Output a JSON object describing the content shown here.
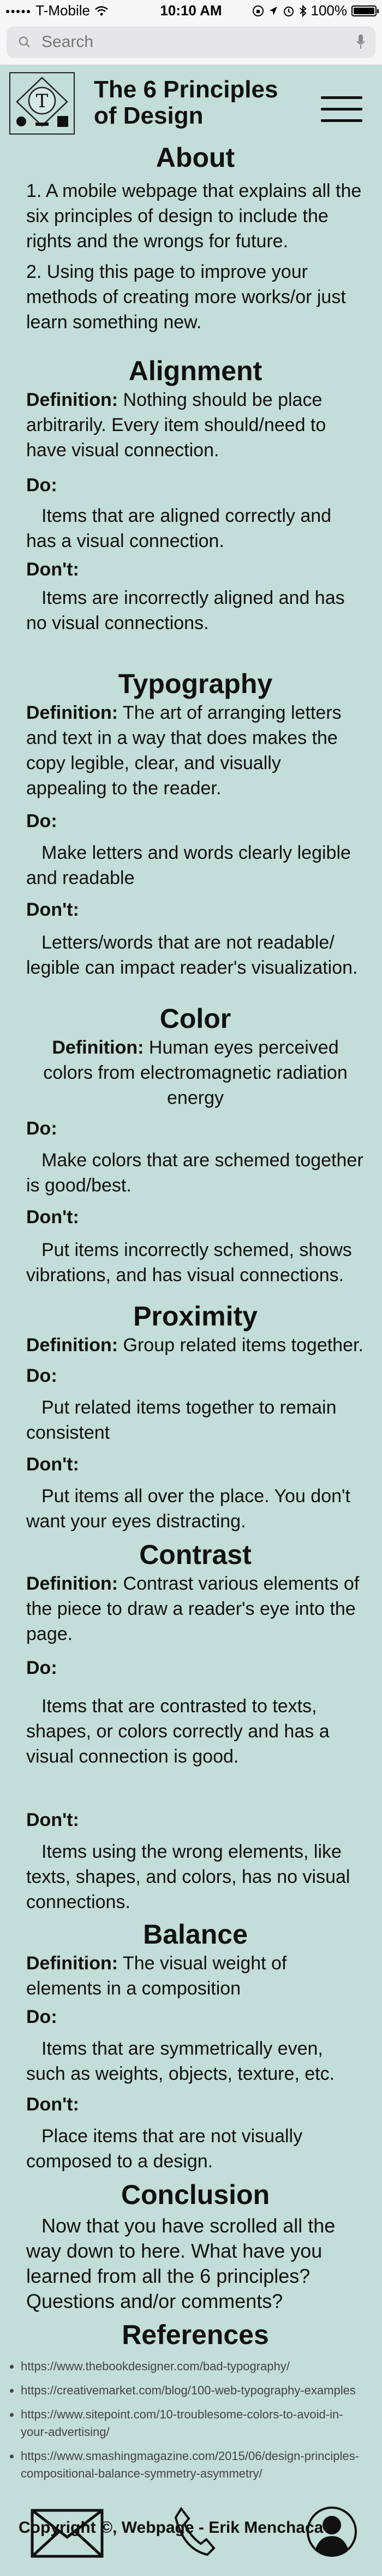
{
  "status_bar": {
    "carrier": "T-Mobile",
    "time": "10:10 AM",
    "battery": "100%",
    "battery_level": 1.0
  },
  "search": {
    "placeholder": "Search"
  },
  "header": {
    "logo_letter": "T",
    "title_line1": "The 6 Principles",
    "title_line2": "of Design"
  },
  "about": {
    "title": "About",
    "items": [
      "1.  A mobile webpage that explains all the six principles of design to include the rights and the wrongs for future.",
      "2.  Using this page to improve your methods of creating more works/or just learn something new."
    ]
  },
  "labels": {
    "definition": "Definition:",
    "do": "Do:",
    "dont": "Don't:"
  },
  "principles": [
    {
      "title": "Alignment",
      "definition": "Nothing should be place arbitrarily. Every item should/need to have visual connection.",
      "do": "Items that are aligned correctly and has a visual connection.",
      "dont": "Items are incorrectly aligned and has no visual connections."
    },
    {
      "title": "Typography",
      "definition": "The art of arranging letters and text in a way that does makes the copy legible, clear, and visually appealing to the reader.",
      "do": "Make letters and words clearly legible and readable",
      "dont": "Letters/words that are not readable/ legible can impact reader's visualization."
    },
    {
      "title": "Color",
      "definition": "Human eyes perceived colors from electromagnetic radiation energy",
      "do": "Make colors that are schemed together is good/best.",
      "dont": "Put items incorrectly schemed, shows vibrations, and has visual connections."
    },
    {
      "title": "Proximity",
      "definition": "Group related items together.",
      "do": "Put related items together to remain consistent",
      "dont": "Put items all over the place. You don't want your eyes distracting."
    },
    {
      "title": "Contrast",
      "definition": "Contrast various elements of the piece to draw a reader's eye into the page.",
      "do": "Items that are contrasted to texts, shapes, or colors correctly and has a visual connection is good.",
      "dont": "Items using the wrong elements, like texts, shapes, and colors, has no visual connections."
    },
    {
      "title": "Balance",
      "definition": "The visual weight of elements in a composition",
      "do": "Items that are symmetrically even, such as weights, objects, texture, etc.",
      "dont": "Place items that are not visually composed to a design."
    }
  ],
  "conclusion": {
    "title": "Conclusion",
    "text": "Now that you have scrolled all the way down to here. What have you learned from all the 6 principles? Questions and/or comments?"
  },
  "references": {
    "title": "References",
    "links": [
      "https://www.thebookdesigner.com/bad-typography/",
      "https://creativemarket.com/blog/100-web-typography-examples",
      "https://www.sitepoint.com/10-troublesome-colors-to-avoid-in-your-advertising/",
      "https://www.smashingmagazine.com/2015/06/design-principles-compositional-balance-symmetry-asymmetry/"
    ]
  },
  "footer": {
    "copyright": "Copyright ©, Webpage - Erik Menchaca",
    "icons": [
      "mail-icon",
      "phone-icon",
      "profile-icon"
    ]
  }
}
